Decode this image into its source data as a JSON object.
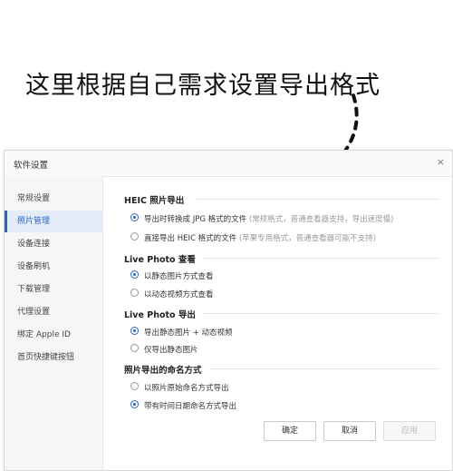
{
  "annotation": {
    "text": "这里根据自己需求设置导出格式"
  },
  "dialog": {
    "title": "软件设置",
    "close_icon": "×"
  },
  "sidebar": {
    "items": [
      {
        "label": "常规设置"
      },
      {
        "label": "照片管理"
      },
      {
        "label": "设备连接"
      },
      {
        "label": "设备刷机"
      },
      {
        "label": "下载管理"
      },
      {
        "label": "代理设置"
      },
      {
        "label": "绑定 Apple ID"
      },
      {
        "label": "首页快捷键按钮"
      }
    ],
    "active_index": 1
  },
  "sections": [
    {
      "title": "HEIC 照片导出",
      "options": [
        {
          "label": "导出时转换成 JPG 格式的文件",
          "note": "(常规格式，普通查看器支持，导出速度慢)",
          "checked": true
        },
        {
          "label": "直接导出 HEIC 格式的文件",
          "note": "(苹果专用格式，普通查看器可能不支持)",
          "checked": false
        }
      ]
    },
    {
      "title": "Live Photo 查看",
      "options": [
        {
          "label": "以静态图片方式查看",
          "checked": true
        },
        {
          "label": "以动态视频方式查看",
          "checked": false
        }
      ]
    },
    {
      "title": "Live Photo 导出",
      "options": [
        {
          "label": "导出静态图片 + 动态视频",
          "checked": true
        },
        {
          "label": "仅导出静态图片",
          "checked": false
        }
      ]
    },
    {
      "title": "照片导出的命名方式",
      "options": [
        {
          "label": "以照片原始命名方式导出",
          "checked": false
        },
        {
          "label": "带有时间日期命名方式导出",
          "checked": true
        }
      ]
    }
  ],
  "buttons": {
    "ok": "确定",
    "cancel": "取消",
    "apply": "应用"
  },
  "colors": {
    "accent": "#2a64c4"
  }
}
